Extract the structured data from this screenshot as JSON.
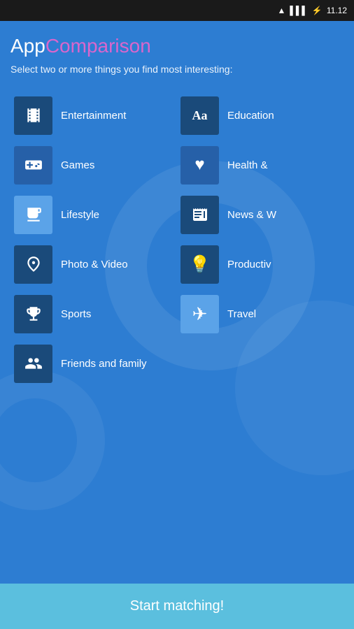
{
  "statusBar": {
    "time": "11.12",
    "icons": [
      "wifi",
      "signal",
      "battery"
    ]
  },
  "header": {
    "titleApp": "App",
    "titleComparison": "Comparison",
    "subtitle": "Select two or more things you find most interesting:"
  },
  "leftCategories": [
    {
      "id": "entertainment",
      "label": "Entertainment",
      "icon": "🎬",
      "iconStyle": "dark"
    },
    {
      "id": "games",
      "label": "Games",
      "icon": "🎮",
      "iconStyle": "medium"
    },
    {
      "id": "lifestyle",
      "label": "Lifestyle",
      "icon": "🍸",
      "iconStyle": "light"
    },
    {
      "id": "photo-video",
      "label": "Photo & Video",
      "icon": "📷",
      "iconStyle": "dark"
    },
    {
      "id": "sports",
      "label": "Sports",
      "icon": "🏆",
      "iconStyle": "dark"
    },
    {
      "id": "friends-family",
      "label": "Friends and family",
      "icon": "👥",
      "iconStyle": "dark"
    }
  ],
  "rightCategories": [
    {
      "id": "education",
      "label": "Education",
      "icon": "Aa",
      "iconStyle": "dark",
      "isText": true
    },
    {
      "id": "health",
      "label": "Health &",
      "icon": "♥",
      "iconStyle": "medium"
    },
    {
      "id": "news",
      "label": "News & W",
      "icon": "📰",
      "iconStyle": "dark"
    },
    {
      "id": "productivity",
      "label": "Productiv",
      "icon": "💡",
      "iconStyle": "dark"
    },
    {
      "id": "travel",
      "label": "Travel",
      "icon": "✈",
      "iconStyle": "light"
    }
  ],
  "startButton": {
    "label": "Start matching!"
  }
}
